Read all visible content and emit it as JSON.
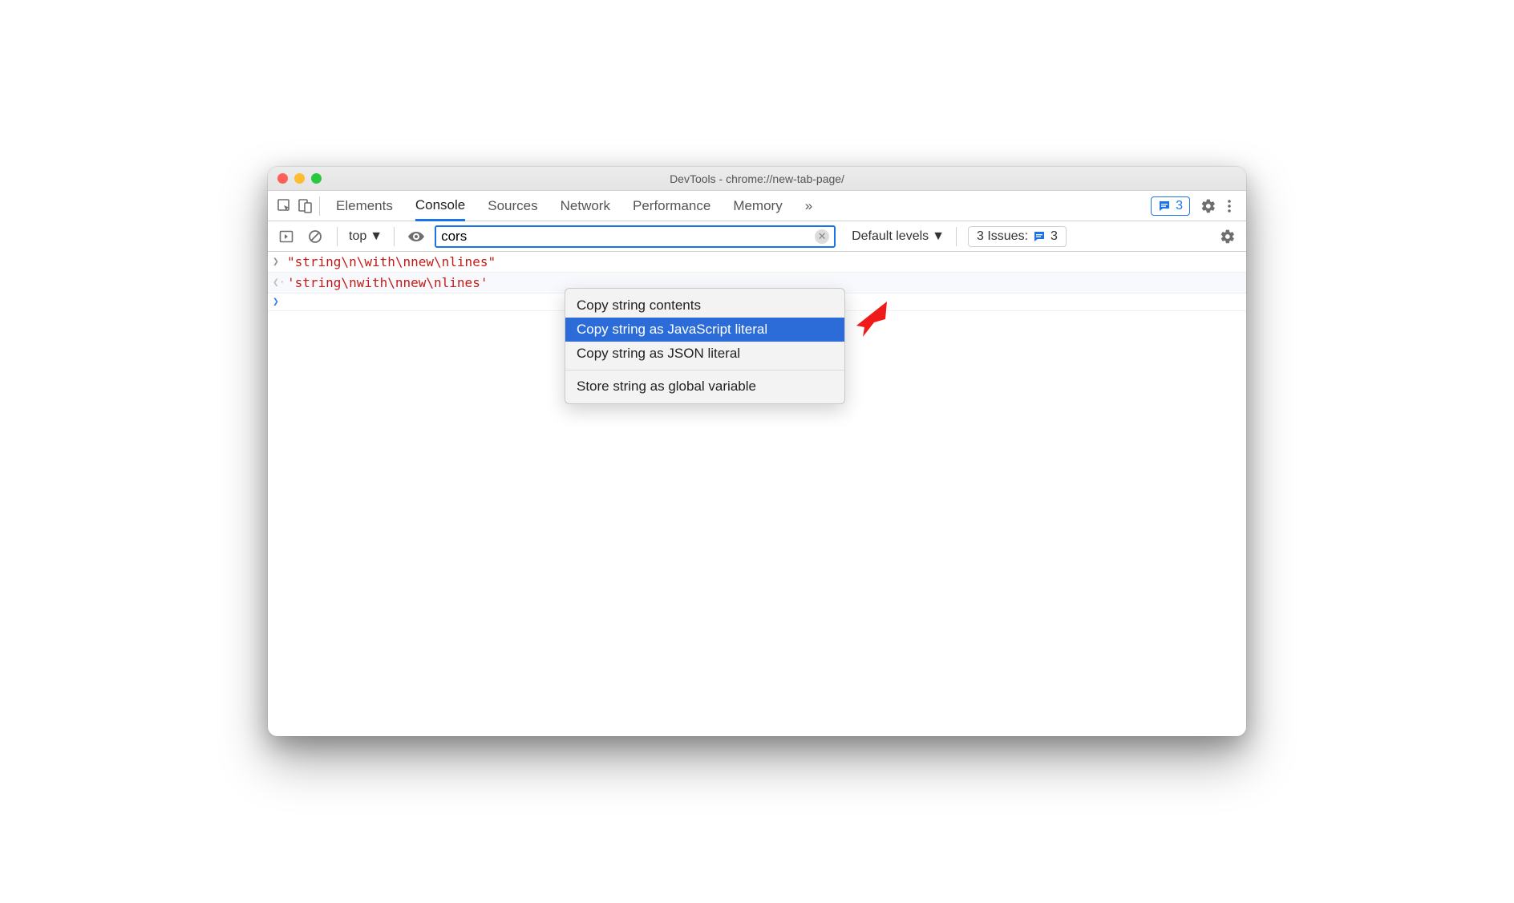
{
  "window_title": "DevTools - chrome://new-tab-page/",
  "tabs": [
    "Elements",
    "Console",
    "Sources",
    "Network",
    "Performance",
    "Memory"
  ],
  "active_tab": "Console",
  "overflow": "»",
  "badge_count": "3",
  "toolbar": {
    "context": "top",
    "filter_value": "cors",
    "levels": "Default levels",
    "issues_label": "3 Issues:",
    "issues_count": "3"
  },
  "console_lines": {
    "input": "\"string\\n\\with\\nnew\\nlines\"",
    "output": "'string\\nwith\\nnew\\nlines'"
  },
  "context_menu": {
    "items": [
      "Copy string contents",
      "Copy string as JavaScript literal",
      "Copy string as JSON literal"
    ],
    "highlighted_index": 1,
    "footer": "Store string as global variable"
  }
}
